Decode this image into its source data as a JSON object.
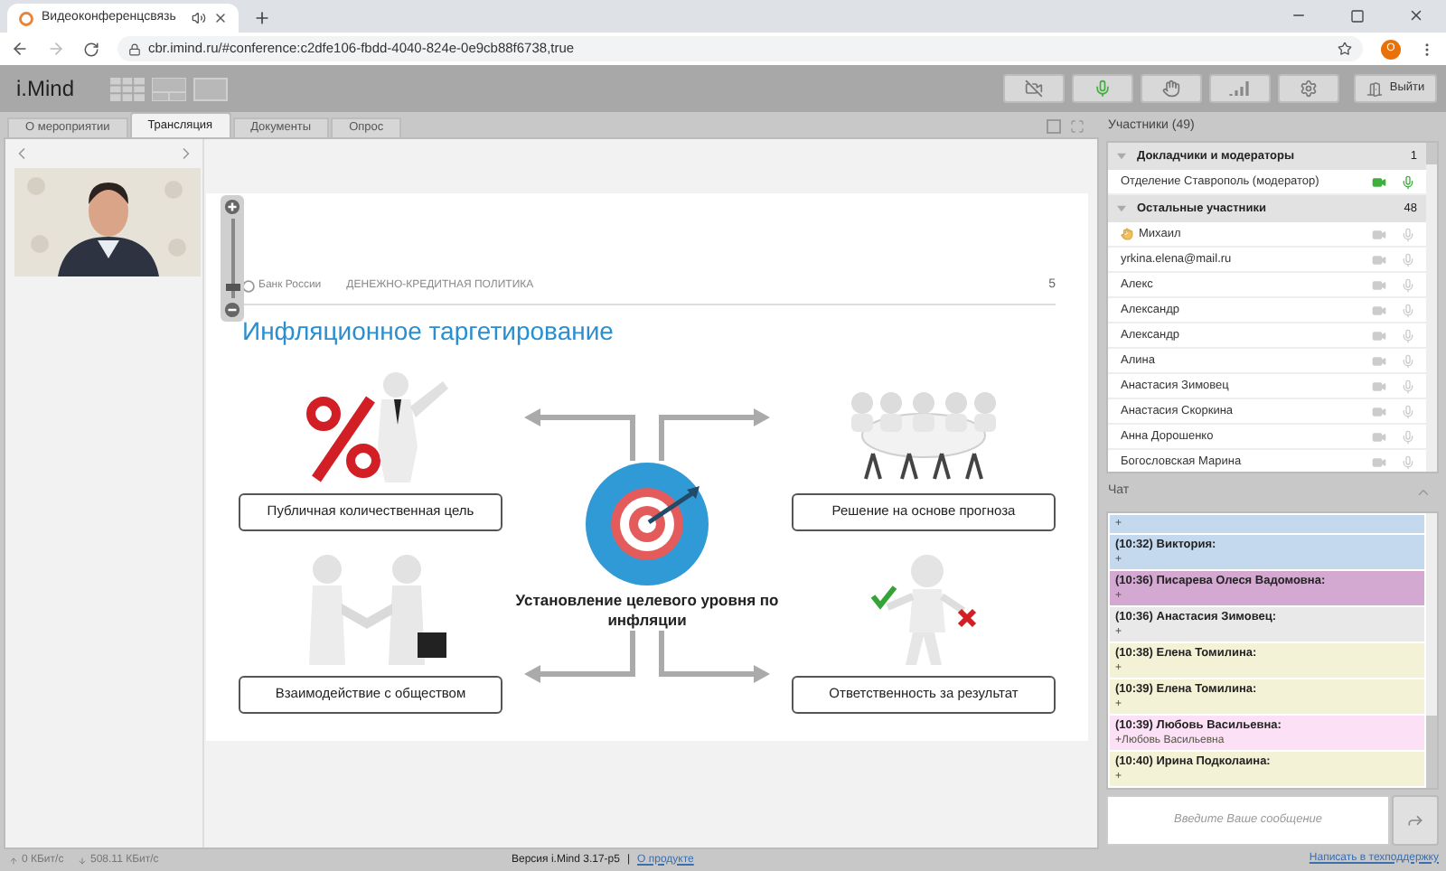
{
  "browser": {
    "tab_title": "Видеоконференцсвязь",
    "url": "cbr.imind.ru/#conference:c2dfe106-fbdd-4040-824e-0e9cb88f6738,true",
    "profile_initial": "O"
  },
  "app": {
    "logo": "i.Mind",
    "exit_button": "Выйти"
  },
  "tabs": [
    {
      "label": "О мероприятии",
      "selected": false
    },
    {
      "label": "Трансляция",
      "selected": true
    },
    {
      "label": "Документы",
      "selected": false
    },
    {
      "label": "Опрос",
      "selected": false
    }
  ],
  "slide": {
    "org": "Банк России",
    "section": "ДЕНЕЖНО-КРЕДИТНАЯ ПОЛИТИКА",
    "page": "5",
    "title": "Инфляционное таргетирование",
    "center": "Установление целевого уровня по инфляции",
    "items": [
      {
        "label": "Публичная количественная цель",
        "kind": "percent"
      },
      {
        "label": "Решение на основе прогноза",
        "kind": "meeting"
      },
      {
        "label": "Взаимодействие с обществом",
        "kind": "handshake"
      },
      {
        "label": "Ответственность за результат",
        "kind": "choice"
      }
    ]
  },
  "participants": {
    "title": "Участники (49)",
    "groups": [
      {
        "title": "Докладчики и модераторы",
        "count": "1",
        "expanded": true,
        "members": [
          {
            "name": "Отделение Ставрополь (модератор)",
            "video_on": true,
            "mic_on": true,
            "hand_raised": false
          }
        ]
      },
      {
        "title": "Остальные участники",
        "count": "48",
        "expanded": true,
        "members": [
          {
            "name": "Михаил",
            "video_on": false,
            "mic_on": false,
            "hand_raised": true
          },
          {
            "name": "yrkina.elena@mail.ru",
            "video_on": false,
            "mic_on": false,
            "hand_raised": false
          },
          {
            "name": "Алекс",
            "video_on": false,
            "mic_on": false,
            "hand_raised": false
          },
          {
            "name": "Александр",
            "video_on": false,
            "mic_on": false,
            "hand_raised": false
          },
          {
            "name": "Александр",
            "video_on": false,
            "mic_on": false,
            "hand_raised": false
          },
          {
            "name": "Алина",
            "video_on": false,
            "mic_on": false,
            "hand_raised": false
          },
          {
            "name": "Анастасия Зимовец",
            "video_on": false,
            "mic_on": false,
            "hand_raised": false
          },
          {
            "name": "Анастасия Скоркина",
            "video_on": false,
            "mic_on": false,
            "hand_raised": false
          },
          {
            "name": "Анна Дорошенко",
            "video_on": false,
            "mic_on": false,
            "hand_raised": false
          },
          {
            "name": "Богословская Марина",
            "video_on": false,
            "mic_on": false,
            "hand_raised": false
          }
        ]
      }
    ]
  },
  "chat": {
    "title": "Чат",
    "messages": [
      {
        "text": "+",
        "color": "#c5d9ee"
      },
      {
        "author": "(10:32) Виктория:",
        "text": "+",
        "color": "#c5d9ee"
      },
      {
        "author": "(10:36) Писарева Олеся Вадомовна:",
        "text": "+",
        "color": "#d3a8d1"
      },
      {
        "author": "(10:36) Анастасия Зимовец:",
        "text": "+",
        "color": "#e9e9e9"
      },
      {
        "author": "(10:38) Елена Томилина:",
        "text": "+",
        "color": "#f3f1d6"
      },
      {
        "author": "(10:39) Елена Томилина:",
        "text": "+",
        "color": "#f3f1d6"
      },
      {
        "author": "(10:39) Любовь Васильевна:",
        "text": "+Любовь Васильевна",
        "color": "#fbe0f6"
      },
      {
        "author": "(10:40) Ирина Подколаина:",
        "text": "+",
        "color": "#f3f1d6"
      }
    ],
    "placeholder": "Введите Ваше сообщение",
    "support_link": "Написать в техподдержку"
  },
  "status_bar": {
    "upload": "0 КБит/с",
    "download": "508.11 КБит/с",
    "version": "Версия i.Mind 3.17-p5",
    "separator": "|",
    "about_link": "О продукте"
  }
}
